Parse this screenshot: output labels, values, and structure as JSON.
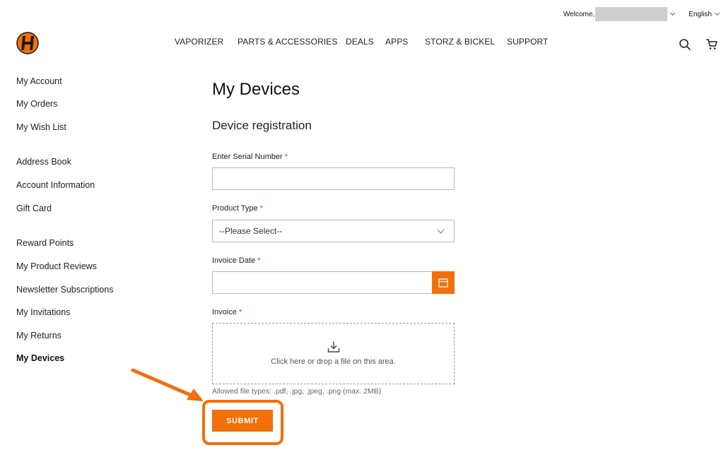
{
  "topbar": {
    "welcome_label": "Welcome, ",
    "language": "English"
  },
  "nav": {
    "items": [
      {
        "label": "VAPORIZER"
      },
      {
        "label": "PARTS & ACCESSORIES"
      },
      {
        "label": "DEALS"
      },
      {
        "label": "APPS"
      },
      {
        "label": "STORZ & BICKEL"
      },
      {
        "label": "SUPPORT"
      }
    ]
  },
  "icons": {
    "logo": "brand-logo",
    "search": "search-icon",
    "cart": "cart-icon",
    "calendar": "calendar-icon",
    "upload": "upload-icon"
  },
  "colors": {
    "accent": "#f36f0a",
    "required": "#e0362c"
  },
  "sidebar": {
    "items": [
      {
        "label": "My Account"
      },
      {
        "label": "My Orders"
      },
      {
        "label": "My Wish List"
      },
      {
        "label": "Address Book"
      },
      {
        "label": "Account Information"
      },
      {
        "label": "Gift Card"
      },
      {
        "label": "Reward Points"
      },
      {
        "label": "My Product Reviews"
      },
      {
        "label": "Newsletter Subscriptions"
      },
      {
        "label": "My Invitations"
      },
      {
        "label": "My Returns"
      },
      {
        "label": "My Devices"
      }
    ]
  },
  "main": {
    "title": "My Devices",
    "section_title": "Device registration",
    "serial": {
      "label": "Enter Serial Number",
      "value": ""
    },
    "product_type": {
      "label": "Product Type",
      "selected": "--Please Select--"
    },
    "invoice_date": {
      "label": "Invoice Date",
      "value": ""
    },
    "invoice": {
      "label": "Invoice",
      "dropzone_text": "Click here or drop a file on this area.",
      "hint": "Allowed file types: .pdf, .jpg, .jpeg, .png (max. 2MB)"
    },
    "required_mark": "*",
    "submit_label": "SUBMIT"
  }
}
